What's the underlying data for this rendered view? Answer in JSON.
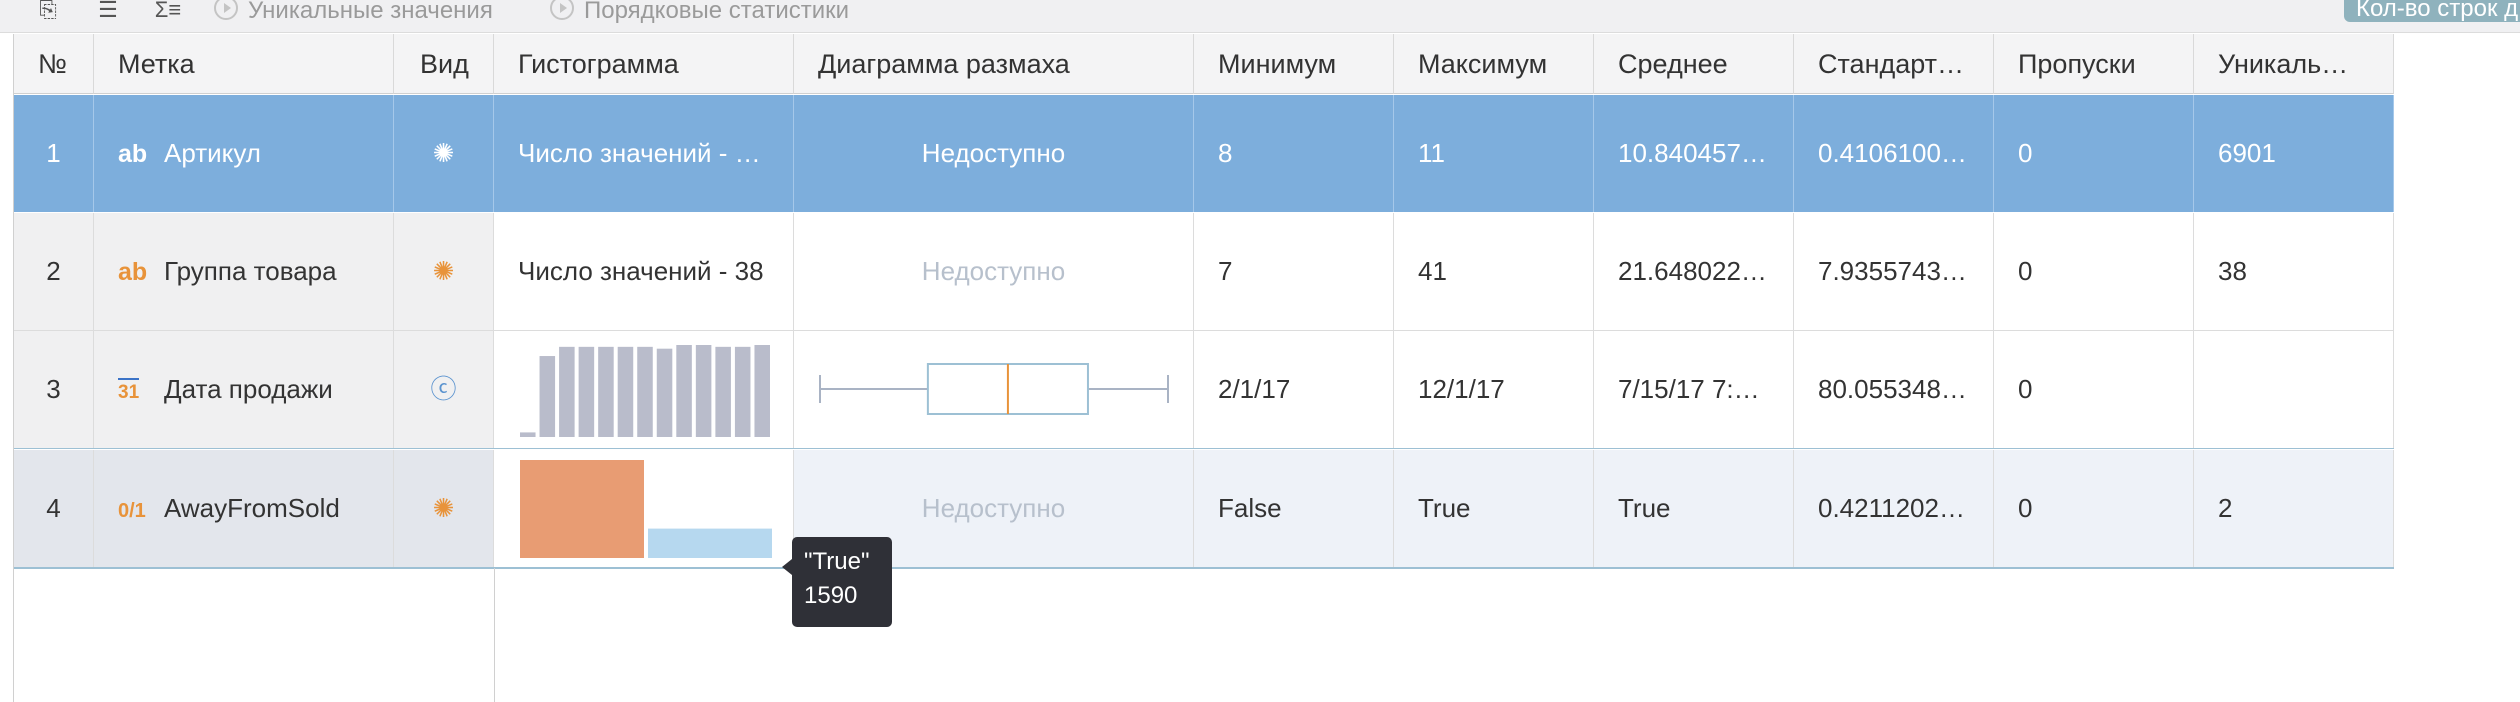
{
  "toolbar": {
    "icons": [
      "export-icon",
      "list-icon",
      "sum-icon"
    ],
    "unique_values_label": "Уникальные значения",
    "ordinal_stats_label": "Порядковые статистики",
    "rows_count_label": "Кол-во строк д"
  },
  "columns": [
    "№",
    "Метка",
    "Вид",
    "Гистограмма",
    "Диаграмма размаха",
    "Минимум",
    "Максимум",
    "Среднее",
    "Стандарт…",
    "Пропуски",
    "Уникаль…"
  ],
  "rows": [
    {
      "num": "1",
      "type_icon": "ab",
      "label": "Артикул",
      "view_icon": "dots-icon",
      "histogram": "Число значений - …",
      "boxplot": "Недоступно",
      "min": "8",
      "max": "11",
      "mean": "10.840457…",
      "std": "0.4106100…",
      "missing": "0",
      "unique": "6901"
    },
    {
      "num": "2",
      "type_icon": "ab",
      "label": "Группа товара",
      "view_icon": "dots-icon",
      "histogram": "Число значений - 38",
      "boxplot": "Недоступно",
      "min": "7",
      "max": "41",
      "mean": "21.648022…",
      "std": "7.9355743…",
      "missing": "0",
      "unique": "38"
    },
    {
      "num": "3",
      "type_icon": "31",
      "label": "Дата продажи",
      "view_icon": "c-icon",
      "histogram": "",
      "boxplot": "",
      "min": "2/1/17",
      "max": "12/1/17",
      "mean": "7/15/17 7:…",
      "std": "80.055348…",
      "missing": "0",
      "unique": ""
    },
    {
      "num": "4",
      "type_icon": "0/1",
      "label": "AwayFromSold",
      "view_icon": "dots-icon",
      "histogram": "",
      "boxplot": "Недоступно",
      "min": "False",
      "max": "True",
      "mean": "True",
      "std": "0.4211202…",
      "missing": "0",
      "unique": "2"
    }
  ],
  "histogram_row3": {
    "values": [
      0.05,
      0.88,
      0.98,
      0.98,
      0.98,
      0.98,
      0.98,
      0.96,
      1.0,
      1.0,
      0.98,
      0.98,
      1.0
    ]
  },
  "boxplot_row3": {
    "whisker_low": 0.0,
    "q1": 0.31,
    "median": 0.54,
    "q3": 0.77,
    "whisker_high": 1.0
  },
  "histogram_row4": {
    "categories": [
      "False",
      "True"
    ],
    "relative": [
      1.0,
      0.3
    ],
    "colors": [
      "#e89c73",
      "#b6d8ef"
    ]
  },
  "tooltip": {
    "line1": "\"True\"",
    "line2": "1590"
  },
  "colors": {
    "selected_row": "#7daedc",
    "accent_orange": "#e8933a",
    "bar_gray": "#b9bccb",
    "box_blue": "#9dc0d4"
  }
}
